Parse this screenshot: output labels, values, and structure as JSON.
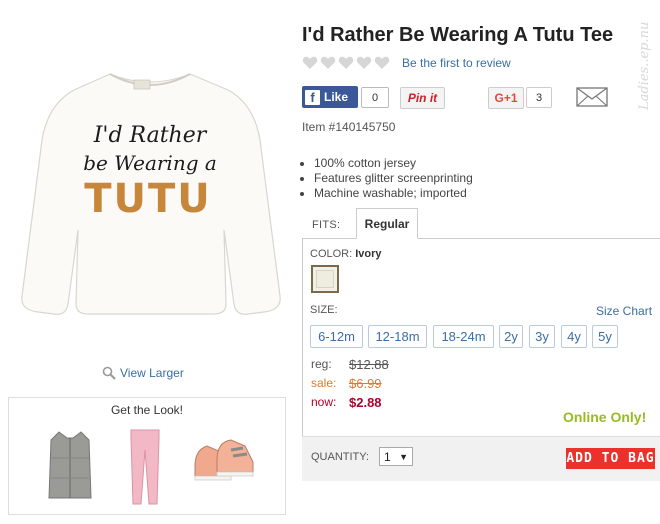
{
  "product": {
    "title": "I'd Rather Be Wearing A Tutu Tee",
    "shirt_text_line1": "I'd Rather",
    "shirt_text_line2": "be Wearing a",
    "shirt_text_line3": "TUTU",
    "view_larger": "View Larger",
    "item_number": "Item #140145750",
    "features": [
      "100% cotton jersey",
      "Features glitter screenprinting",
      "Machine washable; imported"
    ]
  },
  "reviews": {
    "rating": 0,
    "max_rating": 5,
    "link_text": "Be the first to review",
    "icon": "heart-icon"
  },
  "social": {
    "facebook_label": "Like",
    "facebook_count": "0",
    "pinterest_label": "Pin it",
    "gplus_label": "G+1",
    "gplus_count": "3",
    "email_icon": "envelope-icon"
  },
  "watermark": "Ladies..ep.nu",
  "get_the_look": {
    "title": "Get the Look!",
    "items": [
      "vest-icon",
      "pants-icon",
      "shoes-icon"
    ]
  },
  "tabs": {
    "fits_label": "FITS:",
    "active": "Regular"
  },
  "color": {
    "label": "COLOR:",
    "selected": "Ivory",
    "swatch_color": "#efece0"
  },
  "sizes": {
    "label": "SIZE:",
    "chart_link": "Size Chart",
    "options": [
      "6-12m",
      "12-18m",
      "18-24m",
      "2y",
      "3y",
      "4y",
      "5y"
    ]
  },
  "pricing": {
    "reg_label": "reg:",
    "reg_value": "$12.88",
    "sale_label": "sale:",
    "sale_value": "$6.99",
    "now_label": "now:",
    "now_value": "$2.88",
    "online_only": "Online Only!"
  },
  "quantity": {
    "label": "QUANTITY:",
    "value": "1"
  },
  "cart": {
    "add_label": "ADD TO BAG"
  },
  "colors": {
    "link": "#3a6ea5",
    "sale": "#e07a2f",
    "now": "#b0002a",
    "online": "#99bb22",
    "add_to_bag": "#e8322b",
    "facebook": "#3b5998"
  }
}
